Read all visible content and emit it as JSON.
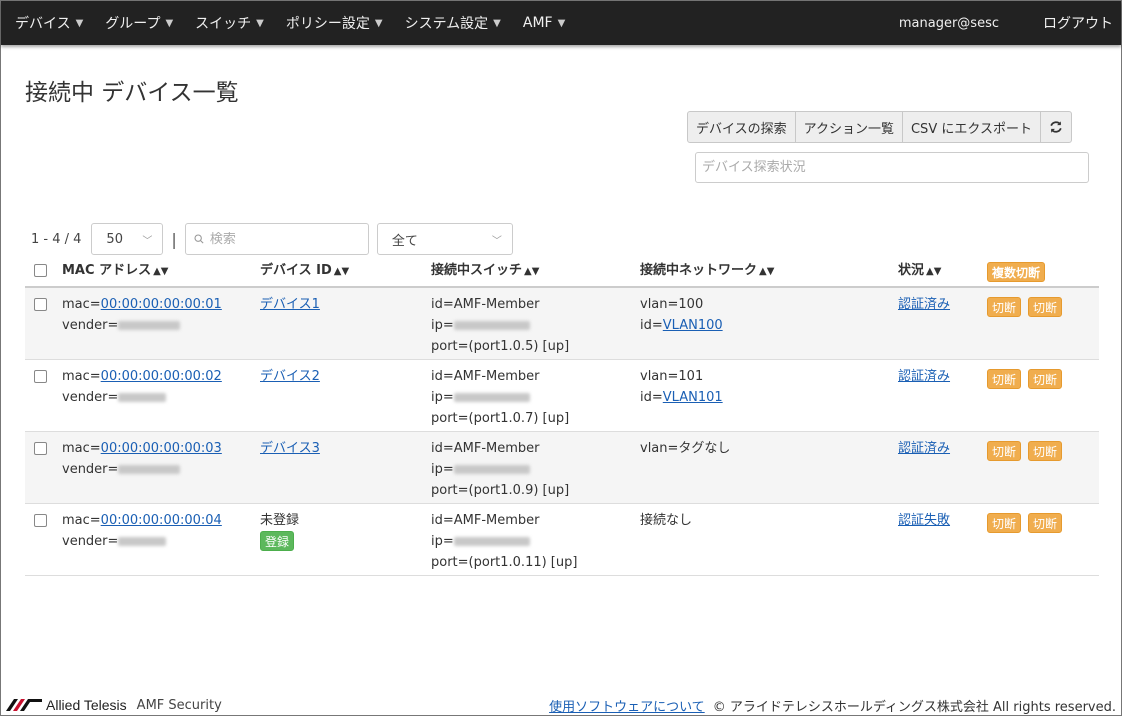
{
  "nav": {
    "items": [
      {
        "label": "デバイス"
      },
      {
        "label": "グループ"
      },
      {
        "label": "スイッチ"
      },
      {
        "label": "ポリシー設定"
      },
      {
        "label": "システム設定"
      },
      {
        "label": "AMF"
      }
    ],
    "user": "manager@sesc",
    "logout": "ログアウト"
  },
  "page": {
    "title": "接続中 デバイス一覧"
  },
  "actions": {
    "discover": "デバイスの探索",
    "action_list": "アクション一覧",
    "csv_export": "CSV にエクスポート",
    "refresh_icon": "refresh-icon",
    "status_placeholder": "デバイス探索状況"
  },
  "toolbar": {
    "count": "1 - 4 / 4",
    "page_size": "50",
    "search_placeholder": "検索",
    "filter": "全て"
  },
  "table": {
    "headers": {
      "mac": "MAC アドレス",
      "device_id": "デバイス ID",
      "switch": "接続中スイッチ",
      "network": "接続中ネットワーク",
      "status": "状況",
      "bulk_disconnect": "複数切断"
    },
    "rows": [
      {
        "mac_prefix": "mac=",
        "mac": "00:00:00:00:00:01",
        "vender_prefix": "vender=",
        "device": "デバイス1",
        "sw_id": "id=AMF-Member",
        "sw_ip_prefix": "ip=",
        "sw_port": "port=(port1.0.5) [up]",
        "net1": "vlan=100",
        "net2_prefix": "id=",
        "net2_link": "VLAN100",
        "status": "認証済み",
        "btn1": "切断",
        "btn2": "切断"
      },
      {
        "mac_prefix": "mac=",
        "mac": "00:00:00:00:00:02",
        "vender_prefix": "vender=",
        "device": "デバイス2",
        "sw_id": "id=AMF-Member",
        "sw_ip_prefix": "ip=",
        "sw_port": "port=(port1.0.7) [up]",
        "net1": "vlan=101",
        "net2_prefix": "id=",
        "net2_link": "VLAN101",
        "status": "認証済み",
        "btn1": "切断",
        "btn2": "切断"
      },
      {
        "mac_prefix": "mac=",
        "mac": "00:00:00:00:00:03",
        "vender_prefix": "vender=",
        "device": "デバイス3",
        "sw_id": "id=AMF-Member",
        "sw_ip_prefix": "ip=",
        "sw_port": "port=(port1.0.9) [up]",
        "net1": "vlan=タグなし",
        "status": "認証済み",
        "btn1": "切断",
        "btn2": "切断"
      },
      {
        "mac_prefix": "mac=",
        "mac": "00:00:00:00:00:04",
        "vender_prefix": "vender=",
        "device_unregistered": "未登録",
        "register": "登録",
        "sw_id": "id=AMF-Member",
        "sw_ip_prefix": "ip=",
        "sw_port": "port=(port1.0.11) [up]",
        "net1": "接続なし",
        "status": "認証失敗",
        "btn1": "切断",
        "btn2": "切断"
      }
    ]
  },
  "footer": {
    "brand": "Allied Telesis",
    "product": "AMF Security",
    "software_link": "使用ソフトウェアについて",
    "copyright": "© アライドテレシスホールディングス株式会社 All rights reserved.",
    "accent_color": "#c8102e"
  }
}
